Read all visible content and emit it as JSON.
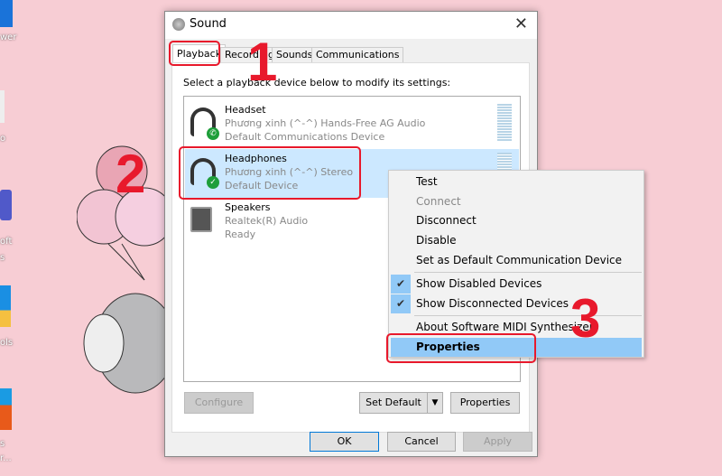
{
  "desktop": {
    "labels": [
      "wer",
      "o",
      "oft",
      "s",
      "ols",
      "s",
      "r..."
    ]
  },
  "dialog": {
    "title": "Sound",
    "tabs": [
      "Playback",
      "Recording",
      "Sounds",
      "Communications"
    ],
    "instruction": "Select a playback device below to modify its settings:",
    "devices": [
      {
        "name": "Headset",
        "driver": "Phương xinh (^-^) Hands-Free AG Audio",
        "status": "Default Communications Device",
        "icon": "headset-icon",
        "badge": "phone-badge-icon"
      },
      {
        "name": "Headphones",
        "driver": "Phương xinh (^-^) Stereo",
        "status": "Default Device",
        "icon": "headphones-icon",
        "badge": "green-check-badge-icon",
        "selected": true
      },
      {
        "name": "Speakers",
        "driver": "Realtek(R) Audio",
        "status": "Ready",
        "icon": "speaker-icon"
      }
    ],
    "buttons": {
      "configure": "Configure",
      "set_default": "Set Default",
      "properties": "Properties",
      "ok": "OK",
      "cancel": "Cancel",
      "apply": "Apply"
    }
  },
  "context_menu": {
    "items": [
      {
        "label": "Test"
      },
      {
        "label": "Connect",
        "disabled": true
      },
      {
        "label": "Disconnect"
      },
      {
        "label": "Disable"
      },
      {
        "label": "Set as Default Communication Device"
      },
      {
        "label": "Show Disabled Devices",
        "checked": true
      },
      {
        "label": "Show Disconnected Devices",
        "checked": true
      },
      {
        "label": "About Software MIDI Synthesizer"
      },
      {
        "label": "Properties",
        "highlighted": true
      }
    ]
  },
  "annotations": [
    "1",
    "2",
    "3"
  ],
  "colors": {
    "annotation": "#e8192c",
    "selection": "#cce8ff",
    "menu_highlight": "#91c9f7"
  }
}
